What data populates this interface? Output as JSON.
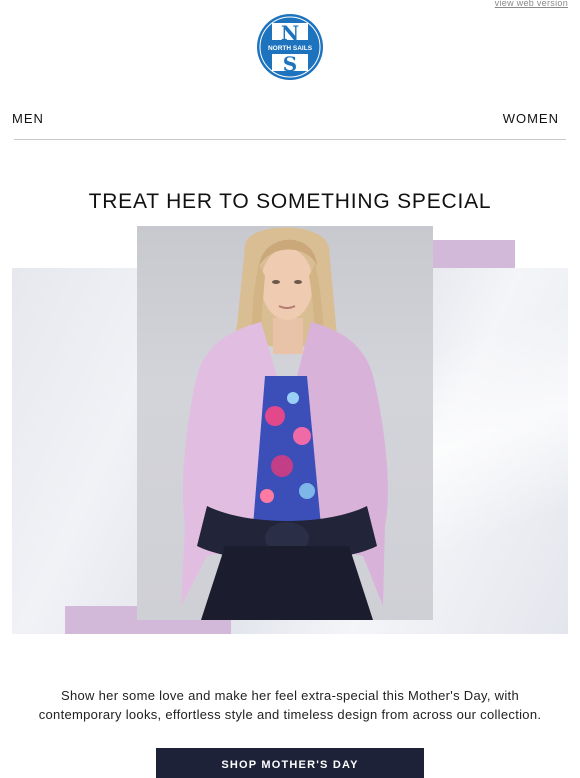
{
  "header": {
    "web_version_link": "view web version",
    "logo": {
      "top_letters": "N",
      "bottom_letter": "S",
      "ring_text": "NORTH SAILS",
      "brand_color": "#1e73be"
    }
  },
  "nav": {
    "men": "MEN",
    "women": "WOMEN"
  },
  "hero": {
    "headline": "TREAT HER TO SOMETHING SPECIAL",
    "accent_color": "#d3b9d9",
    "image": "model-in-lilac-shirt-photo"
  },
  "body": {
    "copy": "Show her some love and make her feel extra-special this Mother's Day, with contemporary looks, effortless style and timeless design from across our collection."
  },
  "cta": {
    "label": "SHOP MOTHER'S DAY",
    "background": "#1d2238"
  }
}
